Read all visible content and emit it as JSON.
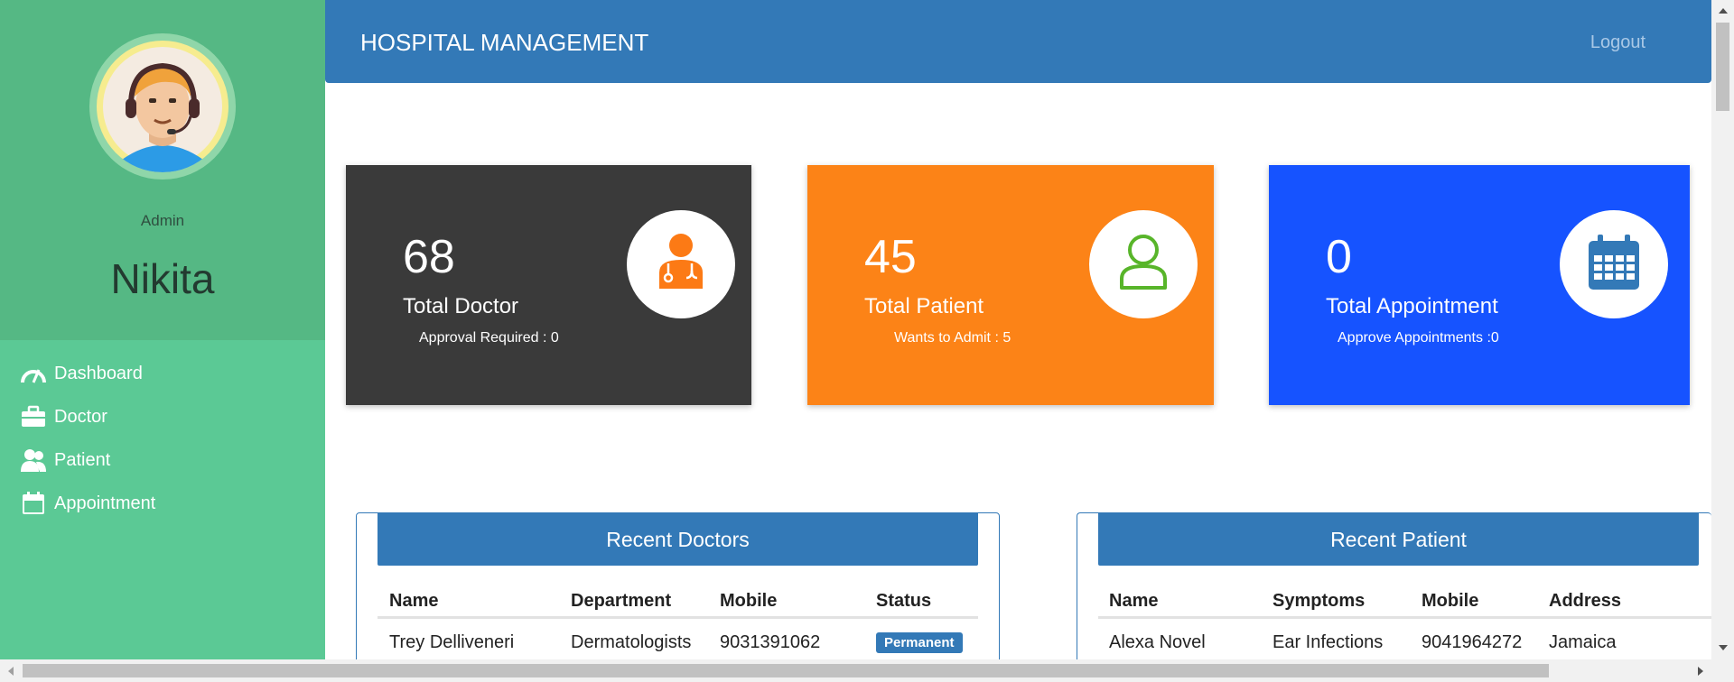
{
  "sidebar": {
    "role": "Admin",
    "username": "Nikita",
    "items": [
      {
        "label": "Dashboard",
        "icon": "speedometer-icon"
      },
      {
        "label": "Doctor",
        "icon": "briefcase-icon"
      },
      {
        "label": "Patient",
        "icon": "users-icon"
      },
      {
        "label": "Appointment",
        "icon": "calendar-icon"
      }
    ]
  },
  "header": {
    "title": "HOSPITAL MANAGEMENT",
    "logout": "Logout"
  },
  "cards": [
    {
      "count": "68",
      "title": "Total Doctor",
      "sub": "Approval Required : 0",
      "color": "#3a3a3a",
      "icon": "doctor-icon"
    },
    {
      "count": "45",
      "title": "Total Patient",
      "sub": "Wants to Admit : 5",
      "color": "#fc8317",
      "icon": "patient-icon"
    },
    {
      "count": "0",
      "title": "Total Appointment",
      "sub": "Approve Appointments :0",
      "color": "#1653ff",
      "icon": "calendar-icon"
    }
  ],
  "recent_doctors": {
    "title": "Recent Doctors",
    "columns": [
      "Name",
      "Department",
      "Mobile",
      "Status"
    ],
    "rows": [
      {
        "name": "Trey Delliveneri",
        "department": "Dermatologists",
        "mobile": "9031391062",
        "status": "Permanent"
      }
    ]
  },
  "recent_patients": {
    "title": "Recent Patient",
    "columns": [
      "Name",
      "Symptoms",
      "Mobile",
      "Address"
    ],
    "rows": [
      {
        "name": "Alexa Novel",
        "symptoms": "Ear Infections",
        "mobile": "9041964272",
        "address": "Jamaica"
      }
    ]
  },
  "colors": {
    "sidebar": "#5bc995",
    "sidebar_profile": "#55b884",
    "header": "#3379b7",
    "accent": "#3379b7"
  }
}
